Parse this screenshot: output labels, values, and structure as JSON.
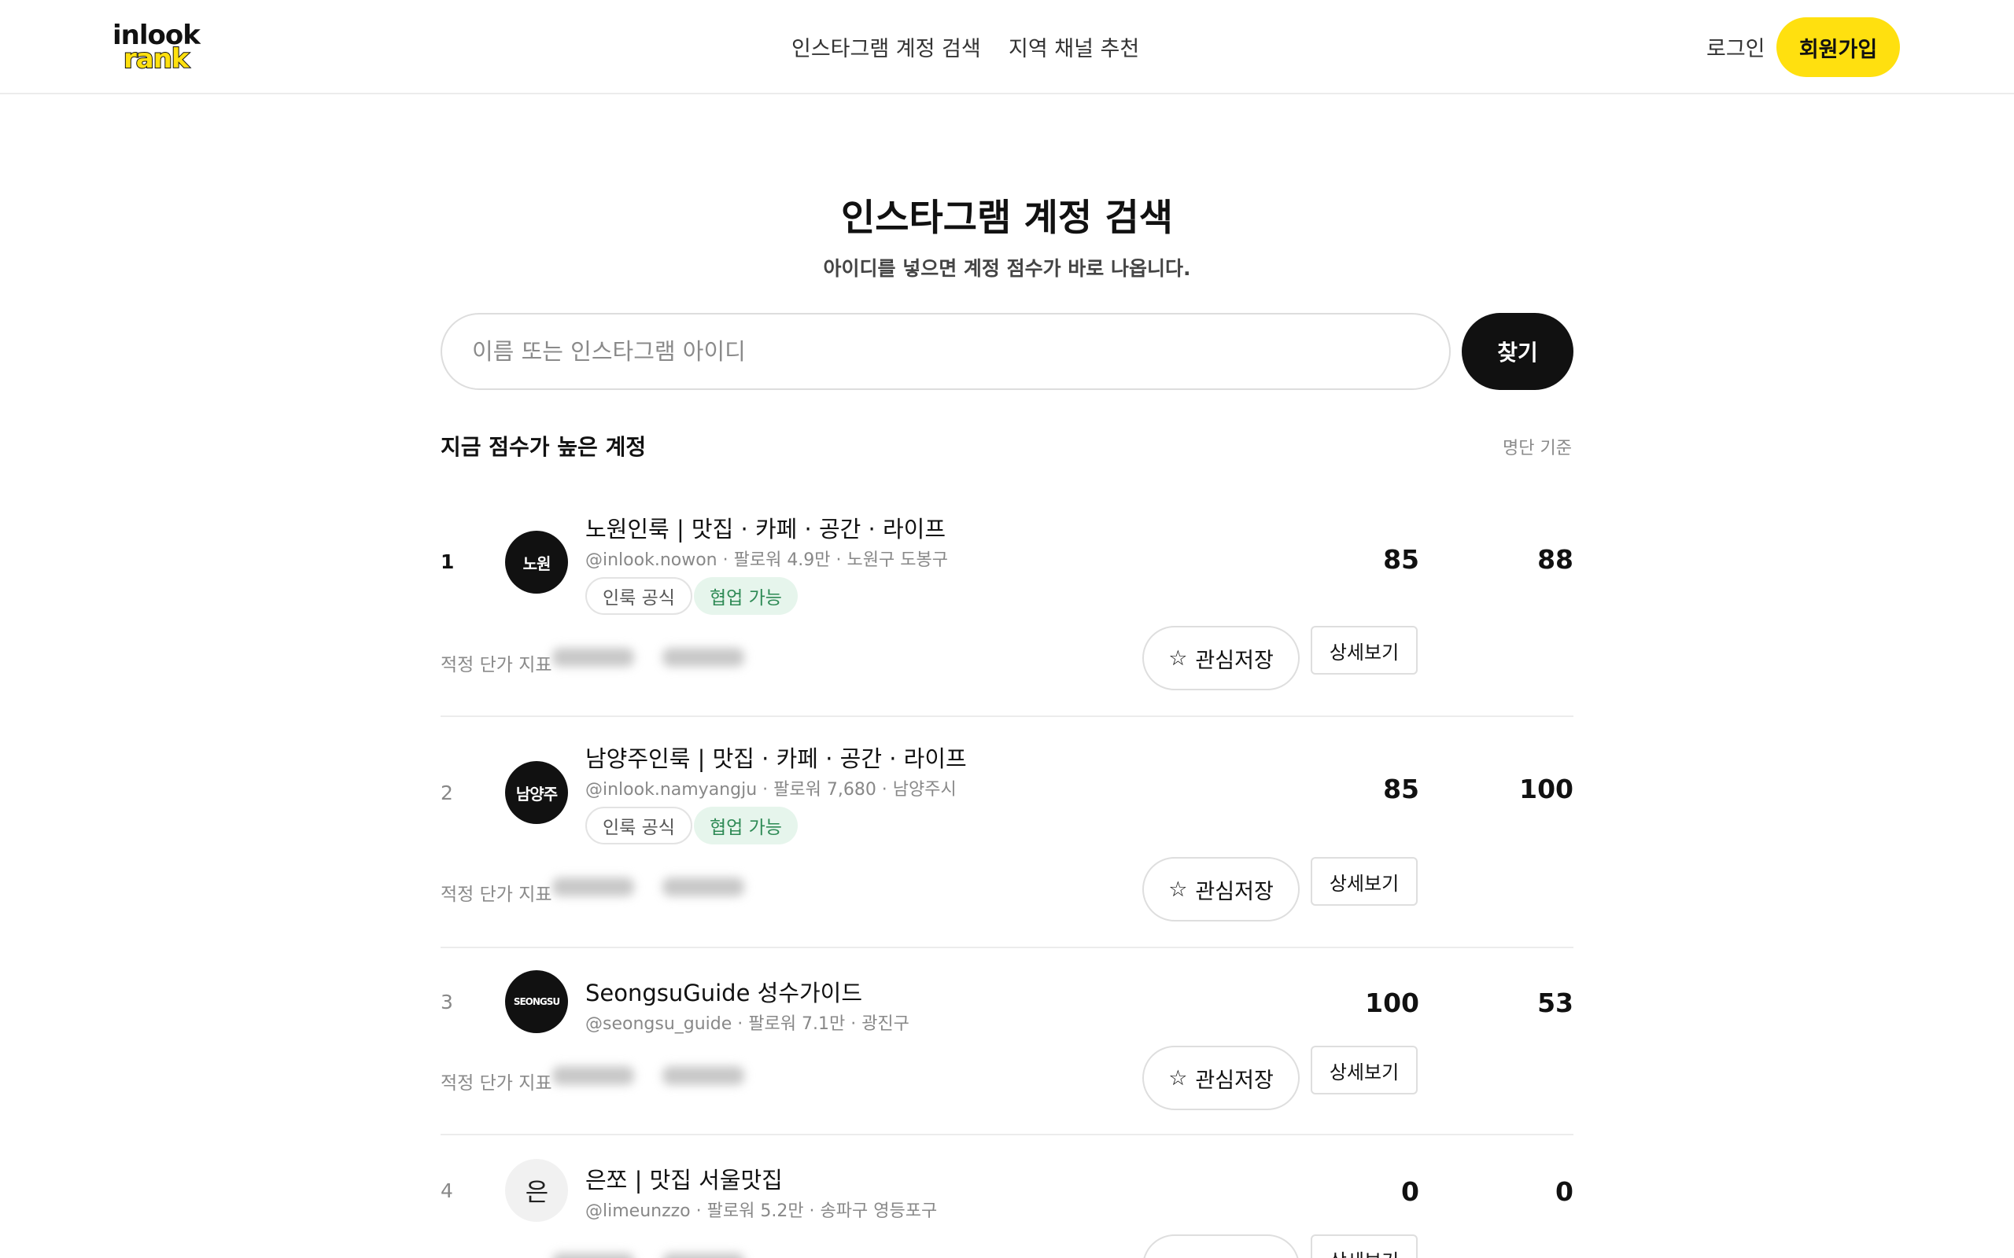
{
  "header": {
    "logo_top": "inlook",
    "logo_bottom": "rank",
    "nav": [
      "인스타그램 계정 검색",
      "지역 채널 추천"
    ],
    "login": "로그인",
    "signup": "회원가입"
  },
  "hero": {
    "title": "인스타그램 계정 검색",
    "subtitle": "아이디를 넣으면 계정 점수가 바로 나옵니다."
  },
  "search": {
    "placeholder": "이름 또는 인스타그램 아이디",
    "value": "",
    "button": "찾기"
  },
  "section": {
    "title": "지금 점수가 높은 계정",
    "note": "명단 기준"
  },
  "common": {
    "price_label": "적정 단가 지표",
    "save_icon": "star-outline-icon",
    "save_label": "관심저장",
    "detail_label": "상세보기"
  },
  "accounts": [
    {
      "rank": "1",
      "avatar": "노원",
      "name": "노원인룩 | 맛집 · 카페 · 공간 · 라이프",
      "meta": "@inlook.nowon  ·  팔로워 4.9만  ·  노원구 도봉구",
      "tags": [
        "인룩 공식",
        "협업 가능"
      ],
      "score1": "85",
      "score2": "88"
    },
    {
      "rank": "2",
      "avatar": "남양주",
      "name": "남양주인룩 | 맛집 · 카페 · 공간 · 라이프",
      "meta": "@inlook.namyangju  ·  팔로워 7,680  ·  남양주시",
      "tags": [
        "인룩 공식",
        "협업 가능"
      ],
      "score1": "85",
      "score2": "100"
    },
    {
      "rank": "3",
      "avatar": "SEONGSU",
      "name": "SeongsuGuide 성수가이드",
      "meta": "@seongsu_guide  ·  팔로워 7.1만  ·  광진구",
      "tags": [],
      "score1": "100",
      "score2": "53"
    },
    {
      "rank": "4",
      "avatar": "은",
      "name": "은쪼 | 맛집 서울맛집",
      "meta": "@limeunzzo  ·  팔로워 5.2만  ·  송파구 영등포구",
      "tags": [],
      "score1": "0",
      "score2": "0"
    }
  ]
}
